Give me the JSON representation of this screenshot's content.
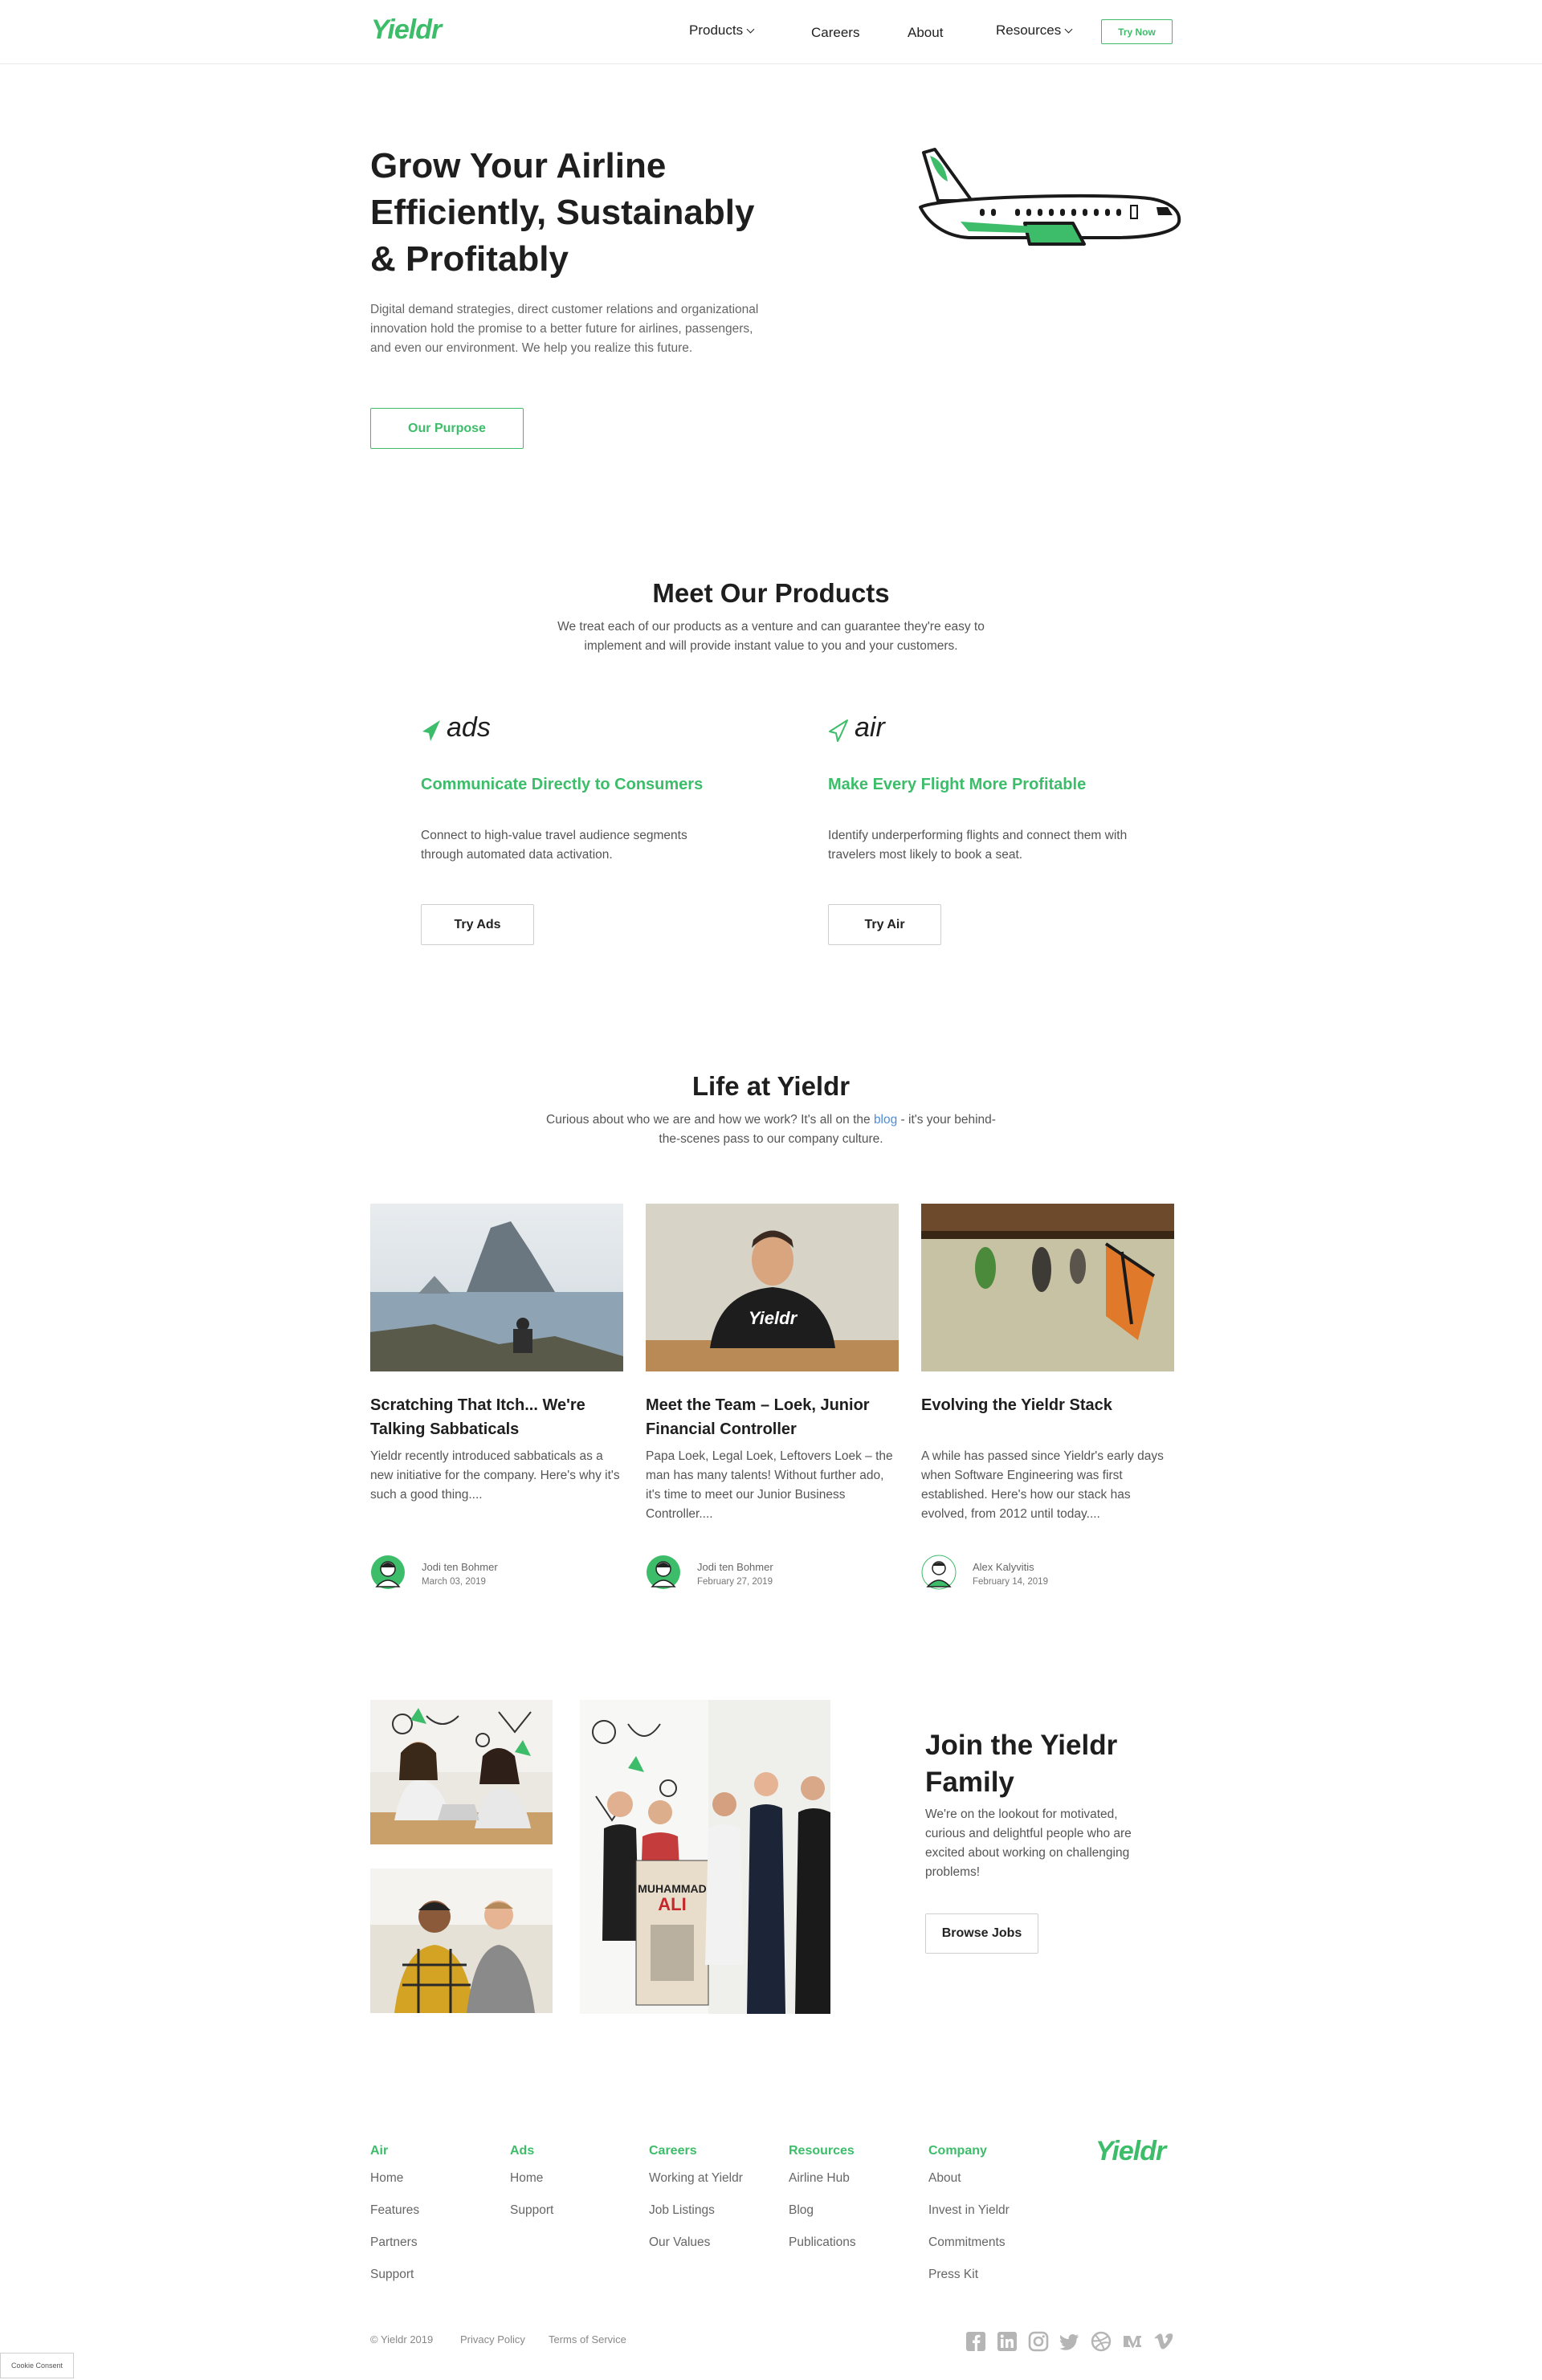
{
  "brand": {
    "name": "Yieldr",
    "green": "#3dbd6a",
    "dark": "#1e1e1e",
    "link_blue": "#4f8cd8"
  },
  "nav": {
    "items": [
      {
        "label": "Products",
        "has_dropdown": true
      },
      {
        "label": "Careers",
        "has_dropdown": false
      },
      {
        "label": "About",
        "has_dropdown": false
      },
      {
        "label": "Resources",
        "has_dropdown": true
      }
    ],
    "cta": "Try Now"
  },
  "hero": {
    "title_lines": [
      "Grow Your Airline",
      "Efficiently, Sustainably",
      "& Profitably"
    ],
    "text": "Digital demand strategies, direct customer relations and organizational innovation hold the promise to a better future for airlines, passengers, and even our environment. We help you realize this future.",
    "button": "Our Purpose",
    "illustration": "airplane-illustration"
  },
  "products_section": {
    "title": "Meet Our Products",
    "subtitle": "We treat each of our products as a venture and can guarantee they're easy to implement and will provide instant value to you and your customers.",
    "products": [
      {
        "logo_text": "ads",
        "icon": "paper-plane-filled-icon",
        "title": "Communicate Directly to Consumers",
        "desc": "Connect to high-value travel audience segments through automated data activation.",
        "button": "Try Ads"
      },
      {
        "logo_text": "air",
        "icon": "paper-plane-outline-icon",
        "title": "Make Every Flight More Profitable",
        "desc": "Identify underperforming flights and connect them with travelers most likely to book a seat.",
        "button": "Try Air"
      }
    ]
  },
  "life_section": {
    "title": "Life at Yieldr",
    "subtitle_before": "Curious about who we are and how we work? It's all on the ",
    "subtitle_link": "blog",
    "subtitle_after": " - it's your behind-the-scenes pass to our company culture.",
    "posts": [
      {
        "title": "Scratching That Itch... We're Talking Sabbaticals",
        "excerpt": "Yieldr recently introduced sabbaticals as a new initiative for the company. Here's why it's such a good thing....",
        "author": "Jodi ten Bohmer",
        "date": "March 03, 2019",
        "image": "island-photo"
      },
      {
        "title": "Meet the Team – Loek, Junior Financial Controller",
        "excerpt": "Papa Loek, Legal Loek, Leftovers Loek – the man has many talents! Without further ado, it's time to meet our Junior Business Controller....",
        "author": "Jodi ten Bohmer",
        "date": "February 27, 2019",
        "image": "team-member-photo",
        "shirt_text": "Yieldr"
      },
      {
        "title": "Evolving the Yieldr Stack",
        "excerpt": "A while has passed since Yieldr's early days when Software Engineering was first established. Here's how our stack has evolved, from 2012 until today....",
        "author": "Alex Kalyvitis",
        "date": "February 14, 2019",
        "image": "butterfly-cocoons-photo"
      }
    ]
  },
  "join_section": {
    "title_lines": [
      "Join the Yieldr",
      "Family"
    ],
    "text": "We're on the lookout for motivated, curious and delightful people who are excited about working on challenging problems!",
    "button": "Browse Jobs",
    "poster_text": [
      "MUHAMMAD",
      "ALI"
    ]
  },
  "footer": {
    "columns": [
      {
        "heading": "Air",
        "links": [
          "Home",
          "Features",
          "Partners",
          "Support"
        ]
      },
      {
        "heading": "Ads",
        "links": [
          "Home",
          "Support"
        ]
      },
      {
        "heading": "Careers",
        "links": [
          "Working at Yieldr",
          "Job Listings",
          "Our Values"
        ]
      },
      {
        "heading": "Resources",
        "links": [
          "Airline Hub",
          "Blog",
          "Publications"
        ]
      },
      {
        "heading": "Company",
        "links": [
          "About",
          "Invest in Yieldr",
          "Commitments",
          "Press Kit"
        ]
      }
    ],
    "logo": "Yieldr",
    "copyright": "© Yieldr 2019",
    "legal_links": [
      "Privacy Policy",
      "Terms of Service"
    ],
    "social_icons": [
      "facebook-icon",
      "linkedin-icon",
      "instagram-icon",
      "twitter-icon",
      "dribbble-icon",
      "medium-icon",
      "vimeo-icon"
    ]
  },
  "cookie": {
    "label": "Cookie Consent"
  }
}
